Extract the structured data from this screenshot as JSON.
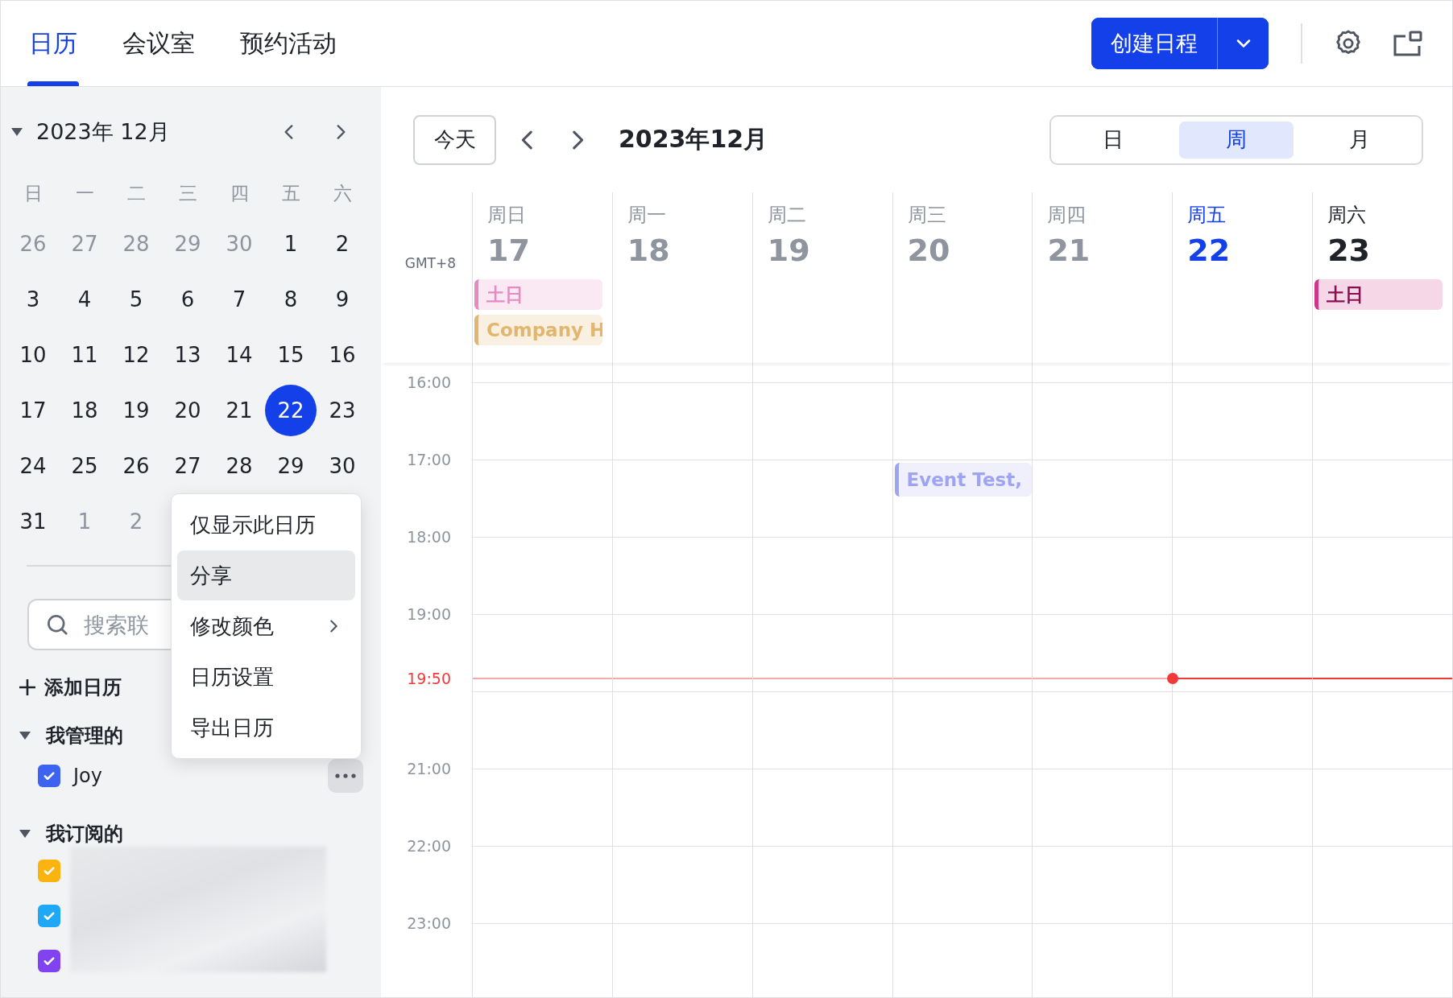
{
  "tabs": [
    {
      "label": "日历",
      "selected": true
    },
    {
      "label": "会议室",
      "selected": false
    },
    {
      "label": "预约活动",
      "selected": false
    }
  ],
  "create_button": {
    "label": "创建日程"
  },
  "mini_calendar": {
    "title": "2023年 12月",
    "weekdays": [
      "日",
      "一",
      "二",
      "三",
      "四",
      "五",
      "六"
    ],
    "weeks": [
      [
        {
          "day": "26",
          "muted": true,
          "selected": false
        },
        {
          "day": "27",
          "muted": true,
          "selected": false
        },
        {
          "day": "28",
          "muted": true,
          "selected": false
        },
        {
          "day": "29",
          "muted": true,
          "selected": false
        },
        {
          "day": "30",
          "muted": true,
          "selected": false
        },
        {
          "day": "1",
          "muted": false,
          "selected": false
        },
        {
          "day": "2",
          "muted": false,
          "selected": false
        }
      ],
      [
        {
          "day": "3",
          "muted": false,
          "selected": false
        },
        {
          "day": "4",
          "muted": false,
          "selected": false
        },
        {
          "day": "5",
          "muted": false,
          "selected": false
        },
        {
          "day": "6",
          "muted": false,
          "selected": false
        },
        {
          "day": "7",
          "muted": false,
          "selected": false
        },
        {
          "day": "8",
          "muted": false,
          "selected": false
        },
        {
          "day": "9",
          "muted": false,
          "selected": false
        }
      ],
      [
        {
          "day": "10",
          "muted": false,
          "selected": false
        },
        {
          "day": "11",
          "muted": false,
          "selected": false
        },
        {
          "day": "12",
          "muted": false,
          "selected": false
        },
        {
          "day": "13",
          "muted": false,
          "selected": false
        },
        {
          "day": "14",
          "muted": false,
          "selected": false
        },
        {
          "day": "15",
          "muted": false,
          "selected": false
        },
        {
          "day": "16",
          "muted": false,
          "selected": false
        }
      ],
      [
        {
          "day": "17",
          "muted": false,
          "selected": false
        },
        {
          "day": "18",
          "muted": false,
          "selected": false
        },
        {
          "day": "19",
          "muted": false,
          "selected": false
        },
        {
          "day": "20",
          "muted": false,
          "selected": false
        },
        {
          "day": "21",
          "muted": false,
          "selected": false
        },
        {
          "day": "22",
          "muted": false,
          "selected": true
        },
        {
          "day": "23",
          "muted": false,
          "selected": false
        }
      ],
      [
        {
          "day": "24",
          "muted": false,
          "selected": false
        },
        {
          "day": "25",
          "muted": false,
          "selected": false
        },
        {
          "day": "26",
          "muted": false,
          "selected": false
        },
        {
          "day": "27",
          "muted": false,
          "selected": false
        },
        {
          "day": "28",
          "muted": false,
          "selected": false
        },
        {
          "day": "29",
          "muted": false,
          "selected": false
        },
        {
          "day": "30",
          "muted": false,
          "selected": false
        }
      ],
      [
        {
          "day": "31",
          "muted": false,
          "selected": false
        },
        {
          "day": "1",
          "muted": true,
          "selected": false
        },
        {
          "day": "2",
          "muted": true,
          "selected": false
        }
      ]
    ]
  },
  "search": {
    "placeholder": "搜索联"
  },
  "add_calendar": {
    "label": "添加日历"
  },
  "groups": [
    {
      "title": "我管理的",
      "expanded": true,
      "calendars": [
        {
          "name": "Joy",
          "checked": true,
          "color": "#3d63f0"
        }
      ]
    },
    {
      "title": "我订阅的",
      "expanded": true,
      "calendars": [
        {
          "checked": true,
          "color": "#fbb40f"
        },
        {
          "checked": true,
          "color": "#1fa8f5"
        },
        {
          "checked": true,
          "color": "#8142f0"
        }
      ]
    }
  ],
  "context_menu": [
    {
      "label": "仅显示此日历",
      "selected": false,
      "submenu": false
    },
    {
      "label": "分享",
      "selected": true,
      "submenu": false
    },
    {
      "label": "修改颜色",
      "selected": false,
      "submenu": true
    },
    {
      "label": "日历设置",
      "selected": false,
      "submenu": false
    },
    {
      "label": "导出日历",
      "selected": false,
      "submenu": false
    }
  ],
  "toolbar": {
    "today": "今天",
    "title": "2023年12月",
    "views": [
      {
        "label": "日",
        "selected": false
      },
      {
        "label": "周",
        "selected": true
      },
      {
        "label": "月",
        "selected": false
      }
    ]
  },
  "week": {
    "timezone": "GMT+8",
    "days": [
      {
        "weekday": "周日",
        "date": "17",
        "past": true,
        "selected": false,
        "all_day": [
          {
            "title": "土日",
            "color": "#e48cc0"
          },
          {
            "title": "Company H",
            "color": "#e2b66c"
          }
        ]
      },
      {
        "weekday": "周一",
        "date": "18",
        "past": true,
        "selected": false
      },
      {
        "weekday": "周二",
        "date": "19",
        "past": true,
        "selected": false
      },
      {
        "weekday": "周三",
        "date": "20",
        "past": true,
        "selected": false,
        "events": [
          {
            "title": "Event Test,",
            "color": "#9ea4f2"
          }
        ]
      },
      {
        "weekday": "周四",
        "date": "21",
        "past": true,
        "selected": false
      },
      {
        "weekday": "周五",
        "date": "22",
        "past": false,
        "selected": true
      },
      {
        "weekday": "周六",
        "date": "23",
        "past": false,
        "selected": false,
        "all_day": [
          {
            "title": "土日",
            "color": "#d0378a"
          }
        ]
      }
    ],
    "hours": [
      {
        "label": "16:00",
        "kind": "hour"
      },
      {
        "label": "17:00",
        "kind": "hour"
      },
      {
        "label": "18:00",
        "kind": "hour"
      },
      {
        "label": "19:00",
        "kind": "hour"
      },
      {
        "label": "19:50",
        "kind": "now"
      },
      {
        "label": "21:00",
        "kind": "hour"
      },
      {
        "label": "22:00",
        "kind": "hour"
      },
      {
        "label": "23:00",
        "kind": "hour"
      }
    ]
  }
}
